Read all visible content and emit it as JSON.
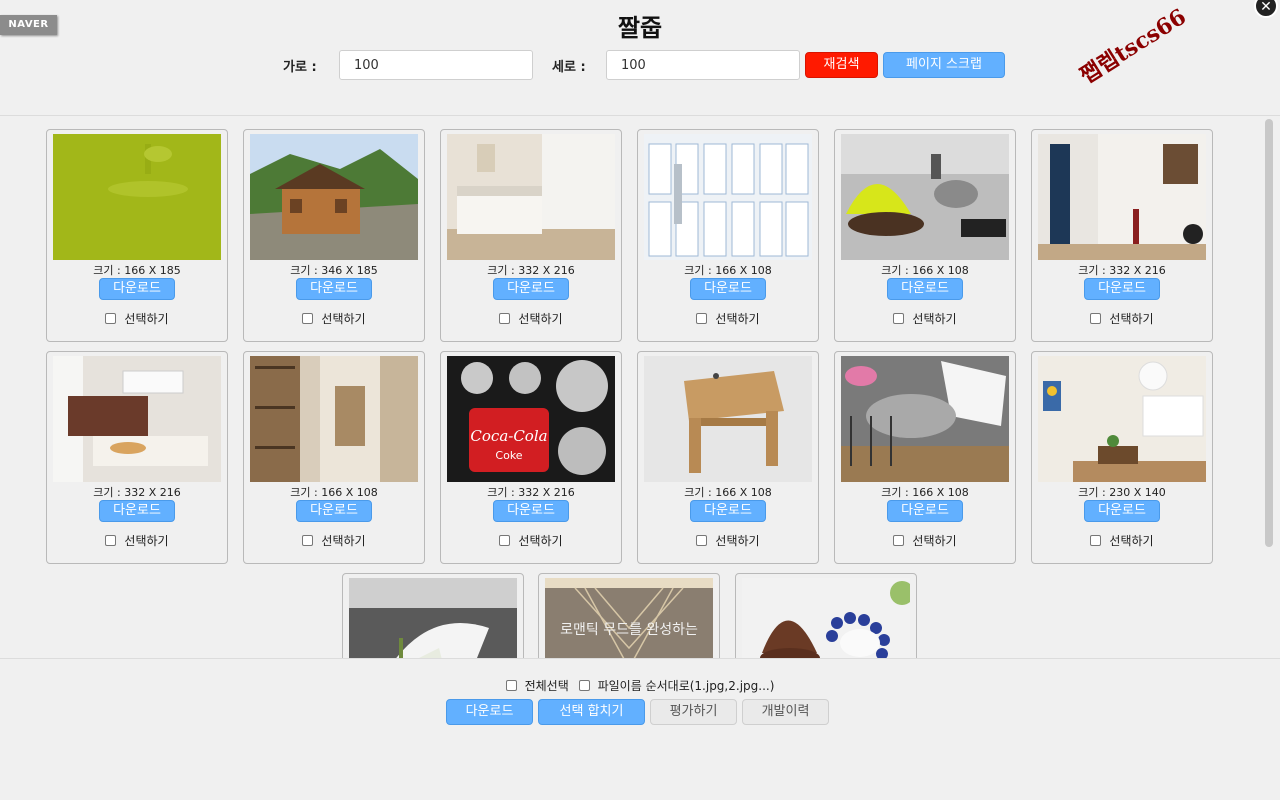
{
  "header": {
    "badge": "NAVER",
    "title": "짤줍",
    "close_symbol": "✕",
    "watermark": "쨉렙tscs66",
    "width_label": "가로 :",
    "width_value": "100",
    "height_label": "세로 :",
    "height_value": "100",
    "research_label": "재검색",
    "scrap_label": "페이지 스크랩"
  },
  "cards": [
    {
      "size": "크기 : 166 X 185",
      "download": "다운로드",
      "select": "선택하기"
    },
    {
      "size": "크기 : 346 X 185",
      "download": "다운로드",
      "select": "선택하기"
    },
    {
      "size": "크기 : 332 X 216",
      "download": "다운로드",
      "select": "선택하기"
    },
    {
      "size": "크기 : 166 X 108",
      "download": "다운로드",
      "select": "선택하기"
    },
    {
      "size": "크기 : 166 X 108",
      "download": "다운로드",
      "select": "선택하기"
    },
    {
      "size": "크기 : 332 X 216",
      "download": "다운로드",
      "select": "선택하기"
    },
    {
      "size": "크기 : 332 X 216",
      "download": "다운로드",
      "select": "선택하기"
    },
    {
      "size": "크기 : 166 X 108",
      "download": "다운로드",
      "select": "선택하기"
    },
    {
      "size": "크기 : 332 X 216",
      "download": "다운로드",
      "select": "선택하기"
    },
    {
      "size": "크기 : 166 X 108",
      "download": "다운로드",
      "select": "선택하기"
    },
    {
      "size": "크기 : 166 X 108",
      "download": "다운로드",
      "select": "선택하기"
    },
    {
      "size": "크기 : 230 X 140",
      "download": "다운로드",
      "select": "선택하기"
    },
    {
      "size": "",
      "download": "",
      "select": ""
    },
    {
      "size": "",
      "download": "",
      "select": ""
    },
    {
      "size": "",
      "download": "",
      "select": ""
    }
  ],
  "thumb_texts": {
    "coke_brand": "Coca-Cola",
    "coke_sub": "Coke",
    "romantic_caption": "로맨틱 무드를 완성하는"
  },
  "footer": {
    "select_all": "전체선택",
    "sequential_names": "파일이름 순서대로(1.jpg,2.jpg...)",
    "download": "다운로드",
    "merge": "선택 합치기",
    "rate": "평가하기",
    "history": "개발이력"
  },
  "colors": {
    "accent_blue": "#62b0ff",
    "accent_red": "#ff1a00",
    "watermark": "#8b0000"
  }
}
